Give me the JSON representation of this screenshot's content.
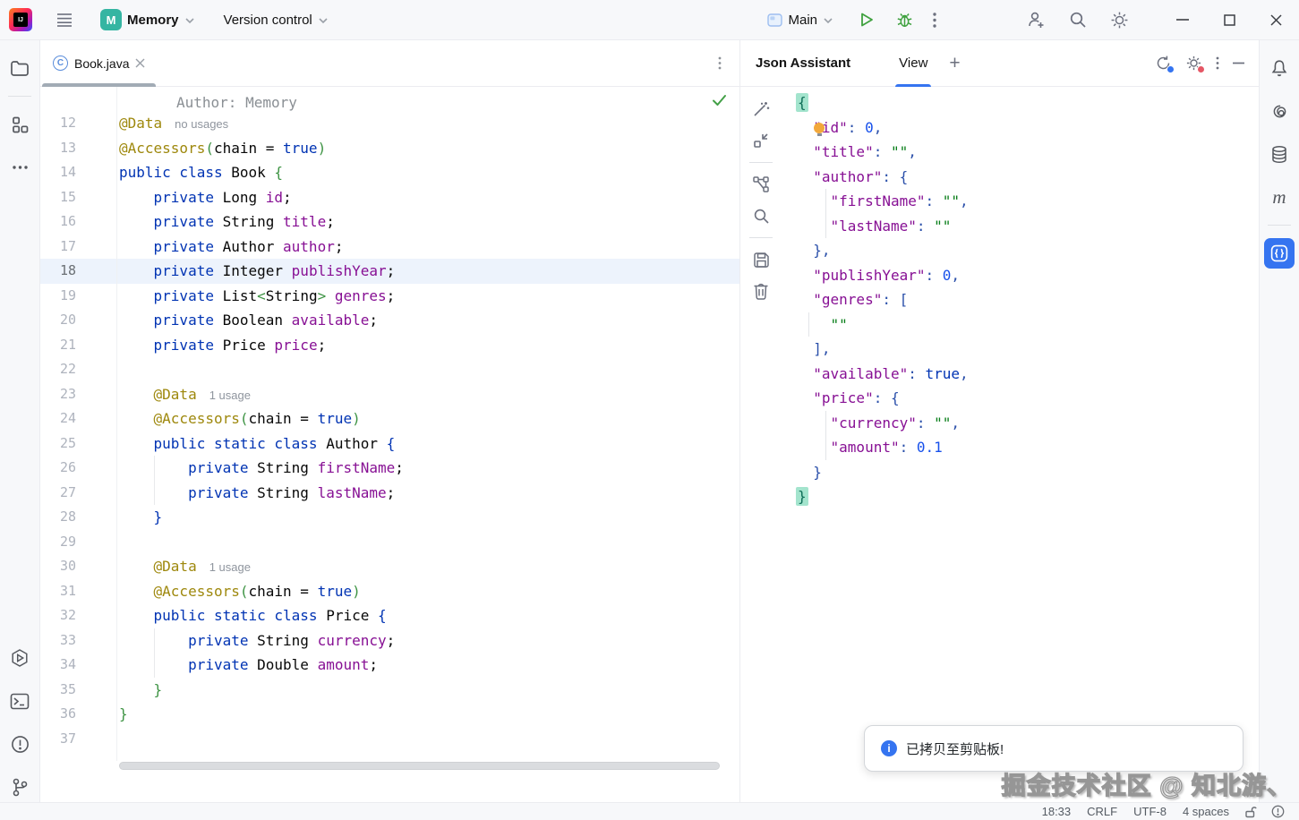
{
  "topbar": {
    "project": "Memory",
    "vcs": "Version control",
    "run_config": "Main"
  },
  "editor": {
    "tab": "Book.java",
    "sticky_line": "Author: Memory",
    "lines": [
      {
        "n": "12",
        "tokens": [
          {
            "t": "@Data",
            "c": "ann"
          }
        ],
        "inlay": "no usages"
      },
      {
        "n": "13",
        "tokens": [
          {
            "t": "@Accessors",
            "c": "ann"
          },
          {
            "t": "(",
            "c": "grn"
          },
          {
            "t": "chain = ",
            "c": "pln"
          },
          {
            "t": "true",
            "c": "kw"
          },
          {
            "t": ")",
            "c": "grn"
          }
        ]
      },
      {
        "n": "14",
        "tokens": [
          {
            "t": "public class ",
            "c": "kw"
          },
          {
            "t": "Book ",
            "c": "pln"
          },
          {
            "t": "{",
            "c": "grn"
          }
        ]
      },
      {
        "n": "15",
        "tokens": [
          {
            "t": "    ",
            "c": "pln"
          },
          {
            "t": "private",
            "c": "kw"
          },
          {
            "t": " Long ",
            "c": "pln"
          },
          {
            "t": "id",
            "c": "fld"
          },
          {
            "t": ";",
            "c": "pln"
          }
        ]
      },
      {
        "n": "16",
        "tokens": [
          {
            "t": "    ",
            "c": "pln"
          },
          {
            "t": "private",
            "c": "kw"
          },
          {
            "t": " String ",
            "c": "pln"
          },
          {
            "t": "title",
            "c": "fld"
          },
          {
            "t": ";",
            "c": "pln"
          }
        ]
      },
      {
        "n": "17",
        "tokens": [
          {
            "t": "    ",
            "c": "pln"
          },
          {
            "t": "private",
            "c": "kw"
          },
          {
            "t": " Author ",
            "c": "pln"
          },
          {
            "t": "author",
            "c": "fld"
          },
          {
            "t": ";",
            "c": "pln"
          }
        ]
      },
      {
        "n": "18",
        "hl": true,
        "tokens": [
          {
            "t": "    ",
            "c": "pln"
          },
          {
            "t": "private",
            "c": "kw"
          },
          {
            "t": " Integer ",
            "c": "pln"
          },
          {
            "t": "publishYear",
            "c": "fld"
          },
          {
            "t": ";",
            "c": "pln"
          }
        ]
      },
      {
        "n": "19",
        "tokens": [
          {
            "t": "    ",
            "c": "pln"
          },
          {
            "t": "private",
            "c": "kw"
          },
          {
            "t": " List",
            "c": "pln"
          },
          {
            "t": "<",
            "c": "grn"
          },
          {
            "t": "String",
            "c": "pln"
          },
          {
            "t": ">",
            "c": "grn"
          },
          {
            "t": " ",
            "c": "pln"
          },
          {
            "t": "genres",
            "c": "fld"
          },
          {
            "t": ";",
            "c": "pln"
          }
        ]
      },
      {
        "n": "20",
        "tokens": [
          {
            "t": "    ",
            "c": "pln"
          },
          {
            "t": "private",
            "c": "kw"
          },
          {
            "t": " Boolean ",
            "c": "pln"
          },
          {
            "t": "available",
            "c": "fld"
          },
          {
            "t": ";",
            "c": "pln"
          }
        ]
      },
      {
        "n": "21",
        "tokens": [
          {
            "t": "    ",
            "c": "pln"
          },
          {
            "t": "private",
            "c": "kw"
          },
          {
            "t": " Price ",
            "c": "pln"
          },
          {
            "t": "price",
            "c": "fld"
          },
          {
            "t": ";",
            "c": "pln"
          }
        ]
      },
      {
        "n": "22",
        "tokens": []
      },
      {
        "n": "23",
        "tokens": [
          {
            "t": "    ",
            "c": "pln"
          },
          {
            "t": "@Data",
            "c": "ann"
          }
        ],
        "inlay": "1 usage"
      },
      {
        "n": "24",
        "tokens": [
          {
            "t": "    ",
            "c": "pln"
          },
          {
            "t": "@Accessors",
            "c": "ann"
          },
          {
            "t": "(",
            "c": "grn"
          },
          {
            "t": "chain = ",
            "c": "pln"
          },
          {
            "t": "true",
            "c": "kw"
          },
          {
            "t": ")",
            "c": "grn"
          }
        ]
      },
      {
        "n": "25",
        "tokens": [
          {
            "t": "    ",
            "c": "pln"
          },
          {
            "t": "public static class ",
            "c": "kw"
          },
          {
            "t": "Author ",
            "c": "pln"
          },
          {
            "t": "{",
            "c": "kw"
          }
        ]
      },
      {
        "n": "26",
        "guide": 39,
        "tokens": [
          {
            "t": "        ",
            "c": "pln"
          },
          {
            "t": "private",
            "c": "kw"
          },
          {
            "t": " String ",
            "c": "pln"
          },
          {
            "t": "firstName",
            "c": "fld"
          },
          {
            "t": ";",
            "c": "pln"
          }
        ]
      },
      {
        "n": "27",
        "guide": 39,
        "tokens": [
          {
            "t": "        ",
            "c": "pln"
          },
          {
            "t": "private",
            "c": "kw"
          },
          {
            "t": " String ",
            "c": "pln"
          },
          {
            "t": "lastName",
            "c": "fld"
          },
          {
            "t": ";",
            "c": "pln"
          }
        ]
      },
      {
        "n": "28",
        "tokens": [
          {
            "t": "    ",
            "c": "pln"
          },
          {
            "t": "}",
            "c": "kw"
          }
        ]
      },
      {
        "n": "29",
        "tokens": []
      },
      {
        "n": "30",
        "tokens": [
          {
            "t": "    ",
            "c": "pln"
          },
          {
            "t": "@Data",
            "c": "ann"
          }
        ],
        "inlay": "1 usage"
      },
      {
        "n": "31",
        "tokens": [
          {
            "t": "    ",
            "c": "pln"
          },
          {
            "t": "@Accessors",
            "c": "ann"
          },
          {
            "t": "(",
            "c": "grn"
          },
          {
            "t": "chain = ",
            "c": "pln"
          },
          {
            "t": "true",
            "c": "kw"
          },
          {
            "t": ")",
            "c": "grn"
          }
        ]
      },
      {
        "n": "32",
        "tokens": [
          {
            "t": "    ",
            "c": "pln"
          },
          {
            "t": "public static class ",
            "c": "kw"
          },
          {
            "t": "Price ",
            "c": "pln"
          },
          {
            "t": "{",
            "c": "kw"
          }
        ]
      },
      {
        "n": "33",
        "guide": 39,
        "tokens": [
          {
            "t": "        ",
            "c": "pln"
          },
          {
            "t": "private",
            "c": "kw"
          },
          {
            "t": " String ",
            "c": "pln"
          },
          {
            "t": "currency",
            "c": "fld"
          },
          {
            "t": ";",
            "c": "pln"
          }
        ]
      },
      {
        "n": "34",
        "guide": 39,
        "tokens": [
          {
            "t": "        ",
            "c": "pln"
          },
          {
            "t": "private",
            "c": "kw"
          },
          {
            "t": " Double ",
            "c": "pln"
          },
          {
            "t": "amount",
            "c": "fld"
          },
          {
            "t": ";",
            "c": "pln"
          }
        ]
      },
      {
        "n": "35",
        "tokens": [
          {
            "t": "    ",
            "c": "pln"
          },
          {
            "t": "}",
            "c": "grn"
          }
        ]
      },
      {
        "n": "36",
        "tokens": [
          {
            "t": "}",
            "c": "grn"
          }
        ]
      },
      {
        "n": "37",
        "tokens": []
      }
    ]
  },
  "json_panel": {
    "title": "Json Assistant",
    "tab_view": "View",
    "add_tab": "+",
    "lines": [
      {
        "tokens": [
          {
            "t": "{",
            "c": "mbr"
          }
        ]
      },
      {
        "bulb": true,
        "tokens": [
          {
            "t": "  ",
            "c": "pun"
          },
          {
            "t": "\"id\"",
            "c": "key"
          },
          {
            "t": ": ",
            "c": "pun"
          },
          {
            "t": "0",
            "c": "num"
          },
          {
            "t": ",",
            "c": "pun"
          }
        ]
      },
      {
        "tokens": [
          {
            "t": "  ",
            "c": "pun"
          },
          {
            "t": "\"title\"",
            "c": "key"
          },
          {
            "t": ": ",
            "c": "pun"
          },
          {
            "t": "\"\"",
            "c": "str"
          },
          {
            "t": ",",
            "c": "pun"
          }
        ]
      },
      {
        "tokens": [
          {
            "t": "  ",
            "c": "pun"
          },
          {
            "t": "\"author\"",
            "c": "key"
          },
          {
            "t": ": {",
            "c": "pun"
          }
        ]
      },
      {
        "guides": [
          33
        ],
        "tokens": [
          {
            "t": "    ",
            "c": "pun"
          },
          {
            "t": "\"firstName\"",
            "c": "key"
          },
          {
            "t": ": ",
            "c": "pun"
          },
          {
            "t": "\"\"",
            "c": "str"
          },
          {
            "t": ",",
            "c": "pun"
          }
        ]
      },
      {
        "guides": [
          33
        ],
        "tokens": [
          {
            "t": "    ",
            "c": "pun"
          },
          {
            "t": "\"lastName\"",
            "c": "key"
          },
          {
            "t": ": ",
            "c": "pun"
          },
          {
            "t": "\"\"",
            "c": "str"
          }
        ]
      },
      {
        "tokens": [
          {
            "t": "  ",
            "c": "pun"
          },
          {
            "t": "},",
            "c": "pun"
          }
        ]
      },
      {
        "tokens": [
          {
            "t": "  ",
            "c": "pun"
          },
          {
            "t": "\"publishYear\"",
            "c": "key"
          },
          {
            "t": ": ",
            "c": "pun"
          },
          {
            "t": "0",
            "c": "num"
          },
          {
            "t": ",",
            "c": "pun"
          }
        ]
      },
      {
        "tokens": [
          {
            "t": "  ",
            "c": "pun"
          },
          {
            "t": "\"genres\"",
            "c": "key"
          },
          {
            "t": ": [",
            "c": "pun"
          }
        ]
      },
      {
        "guides": [
          14
        ],
        "tokens": [
          {
            "t": "    ",
            "c": "pun"
          },
          {
            "t": "\"\"",
            "c": "str"
          }
        ]
      },
      {
        "tokens": [
          {
            "t": "  ",
            "c": "pun"
          },
          {
            "t": "],",
            "c": "pun"
          }
        ]
      },
      {
        "tokens": [
          {
            "t": "  ",
            "c": "pun"
          },
          {
            "t": "\"available\"",
            "c": "key"
          },
          {
            "t": ": ",
            "c": "pun"
          },
          {
            "t": "true",
            "c": "kw"
          },
          {
            "t": ",",
            "c": "pun"
          }
        ]
      },
      {
        "tokens": [
          {
            "t": "  ",
            "c": "pun"
          },
          {
            "t": "\"price\"",
            "c": "key"
          },
          {
            "t": ": {",
            "c": "pun"
          }
        ]
      },
      {
        "guides": [
          33
        ],
        "tokens": [
          {
            "t": "    ",
            "c": "pun"
          },
          {
            "t": "\"currency\"",
            "c": "key"
          },
          {
            "t": ": ",
            "c": "pun"
          },
          {
            "t": "\"\"",
            "c": "str"
          },
          {
            "t": ",",
            "c": "pun"
          }
        ]
      },
      {
        "guides": [
          33
        ],
        "tokens": [
          {
            "t": "    ",
            "c": "pun"
          },
          {
            "t": "\"amount\"",
            "c": "key"
          },
          {
            "t": ": ",
            "c": "pun"
          },
          {
            "t": "0.1",
            "c": "num"
          }
        ]
      },
      {
        "tokens": [
          {
            "t": "  ",
            "c": "pun"
          },
          {
            "t": "}",
            "c": "pun"
          }
        ]
      },
      {
        "tokens": [
          {
            "t": "}",
            "c": "mbr"
          }
        ]
      }
    ]
  },
  "statusbar": {
    "time": "18:33",
    "line_ending": "CRLF",
    "encoding": "UTF-8",
    "indent": "4 spaces"
  },
  "toast": {
    "message": "已拷贝至剪贴板!"
  },
  "watermark": "掘金技术社区 @ 知北游、",
  "icons": {
    "topbar": [
      "app-logo",
      "hamburger-menu",
      "project-badge",
      "chevron-down",
      "run-widget",
      "play",
      "debug-bug",
      "more-vertical",
      "add-user",
      "search",
      "settings-gear",
      "window-minimize",
      "window-maximize",
      "window-close"
    ],
    "left_sidebar": [
      "folder",
      "structure",
      "more-horizontal",
      "services",
      "terminal",
      "problems",
      "git-branch"
    ],
    "right_sidebar": [
      "notifications-bell",
      "ai-swirl",
      "database",
      "maven",
      "json-tool"
    ],
    "json_toolbar": [
      "magic-wand",
      "collapse",
      "nodes",
      "search",
      "save",
      "trash"
    ],
    "json_header": [
      "sync-settings",
      "settings-refresh",
      "more-vertical",
      "hide-panel"
    ],
    "editor": [
      "class-icon",
      "close-tab",
      "more-vertical",
      "inspection-check",
      "lightbulb"
    ],
    "statusbar": [
      "unlocked-padlock",
      "inspections-circle"
    ],
    "toast": [
      "info-circle"
    ]
  }
}
